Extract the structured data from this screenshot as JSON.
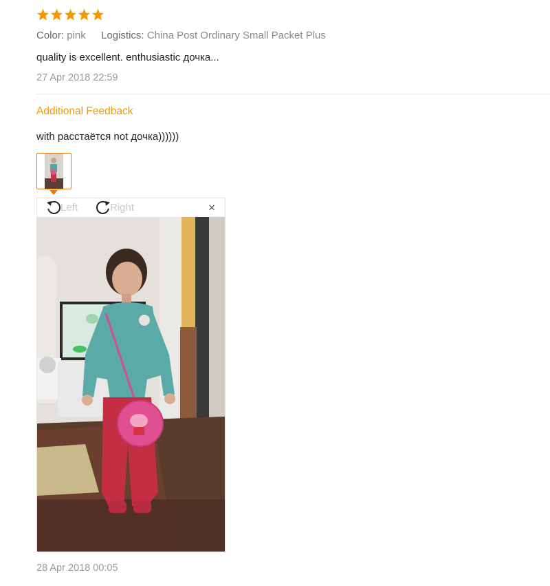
{
  "rating": {
    "stars": 5,
    "max": 5,
    "color": "#f39800"
  },
  "meta": {
    "color_label": "Color:",
    "color_value": "pink",
    "logistics_label": "Logistics:",
    "logistics_value": "China Post Ordinary Small Packet Plus"
  },
  "review": {
    "text": "quality is excellent. enthusiastic дочка...",
    "date": "27 Apr 2018 22:59"
  },
  "additional": {
    "heading": "Additional Feedback",
    "text": "with расстаётся not дочка))))))",
    "date": "28 Apr 2018 00:05"
  },
  "viewer": {
    "rotate_left_label": "Left",
    "rotate_right_label": "Right",
    "close_symbol": "×",
    "icons": [
      "rotate-left-icon",
      "rotate-right-icon",
      "close-icon"
    ]
  }
}
